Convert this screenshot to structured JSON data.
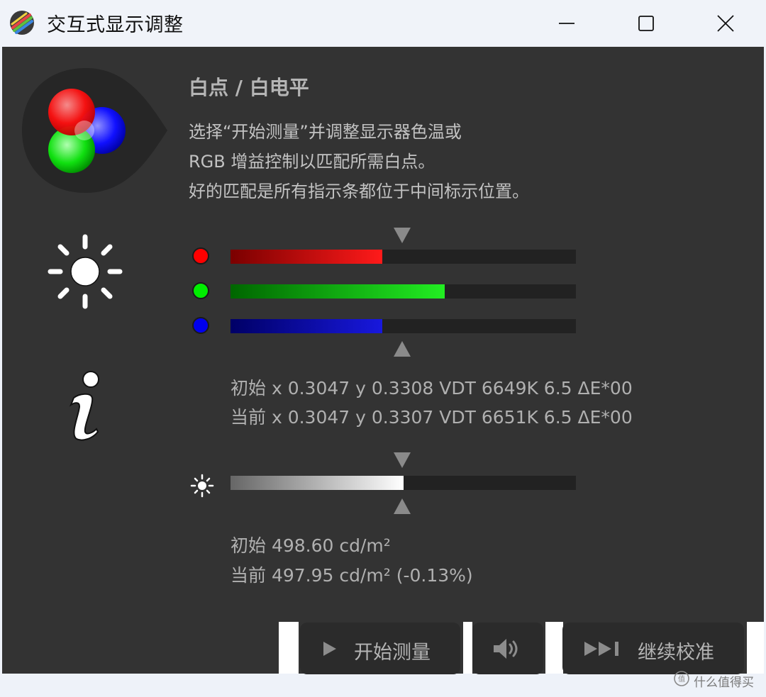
{
  "window": {
    "title": "交互式显示调整"
  },
  "content": {
    "heading": "白点 / 白电平",
    "description": [
      "选择“开始测量”并调整显示器色温或",
      "RGB 增益控制以匹配所需白点。",
      "好的匹配是所有指示条都位于中间标示位置。"
    ]
  },
  "rgb_bars": [
    {
      "name": "red",
      "color": "#ff0000",
      "level": 0.44
    },
    {
      "name": "green",
      "color": "#00ee00",
      "level": 0.62
    },
    {
      "name": "blue",
      "color": "#0000ee",
      "level": 0.44
    }
  ],
  "chromaticity": {
    "initial": "初始 x 0.3047 y 0.3308 VDT 6649K 6.5 ΔE*00",
    "current": "当前 x 0.3047 y 0.3307 VDT 6651K 6.5 ΔE*00"
  },
  "luminance_bar": {
    "level": 0.5
  },
  "luminance": {
    "initial": "初始 498.60 cd/m²",
    "current": "当前 497.95 cd/m² (-0.13%)"
  },
  "buttons": {
    "start_measure": "开始测量",
    "continue_calibration": "继续校准"
  },
  "icons": {
    "app": "displaycal-icon",
    "logo": "rgb-circles-icon",
    "brightness": "sun-icon",
    "info": "info-icon",
    "sound": "speaker-icon"
  },
  "watermark": "什么值得买"
}
